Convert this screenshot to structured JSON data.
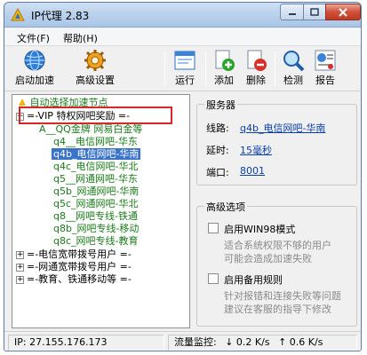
{
  "window": {
    "title": "IP代理 2.83"
  },
  "menu": {
    "file": "文件(F)",
    "help": "帮助(H)"
  },
  "toolbar": {
    "start": "启动加速",
    "advanced": "高级设置",
    "run": "运行",
    "add": "添加",
    "delete": "删除",
    "check": "检测",
    "report": "报告"
  },
  "tree": {
    "auto_node": "自动选择加速节点",
    "vip_group": "=-VIP 特权网吧奖励 =-",
    "items": [
      "A__QQ金牌 网易白金等",
      "q4__电信网吧-华东",
      "q4b_电信网吧-华南",
      "q4c_电信网吧-华北",
      "q5__网通网吧-华东",
      "q5b_网通网吧-华南",
      "q5c_网通网吧-华北",
      "q8__网吧专线-铁通",
      "q8b_网吧专线-移动",
      "q8c_网吧专线-教育"
    ],
    "groups": [
      "=-电信宽带拨号用户 =-",
      "=-网通宽带拨号用户 =-",
      "=-教育、铁通移动等 =-"
    ]
  },
  "server": {
    "title": "服务器",
    "route_label": "线路:",
    "route_value": "q4b_电信网吧-华南",
    "delay_label": "延时:",
    "delay_value": "15毫秒",
    "port_label": "端口:",
    "port_value": "8001"
  },
  "advanced": {
    "title": "高级选项",
    "win98_label": "启用WIN98模式",
    "win98_note_1": "适合系统权限不够的用户",
    "win98_note_2": "可能会造成加速失败",
    "backup_label": "启用备用规则",
    "backup_note_1": "针对报错和连接失败等问题",
    "backup_note_2": "建议在客服的指导下修改"
  },
  "status": {
    "ip": "IP: 27.155.176.173",
    "monitor_label": "流量监控:",
    "down": "↓ 0.2 K/s",
    "up": "↑ 0.6 K/s"
  }
}
